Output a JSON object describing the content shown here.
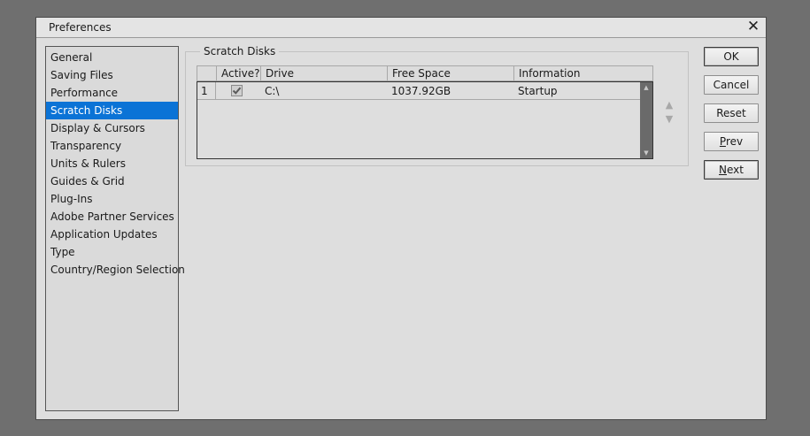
{
  "window": {
    "title": "Preferences"
  },
  "sidebar": {
    "items": [
      {
        "label": "General"
      },
      {
        "label": "Saving Files"
      },
      {
        "label": "Performance"
      },
      {
        "label": "Scratch Disks",
        "selected": true
      },
      {
        "label": "Display & Cursors"
      },
      {
        "label": "Transparency"
      },
      {
        "label": "Units & Rulers"
      },
      {
        "label": "Guides & Grid"
      },
      {
        "label": "Plug-Ins"
      },
      {
        "label": "Adobe Partner Services"
      },
      {
        "label": "Application Updates"
      },
      {
        "label": "Type"
      },
      {
        "label": "Country/Region Selection"
      }
    ]
  },
  "scratch_disks": {
    "group_title": "Scratch Disks",
    "columns": [
      "Active?",
      "Drive",
      "Free Space",
      "Information"
    ],
    "rows": [
      {
        "index": "1",
        "active": true,
        "drive": "C:\\",
        "free_space": "1037.92GB",
        "information": "Startup"
      }
    ]
  },
  "buttons": {
    "ok": "OK",
    "cancel": "Cancel",
    "reset": "Reset",
    "prev": "Prev",
    "next": "Next"
  },
  "icons": {
    "close": "close-icon",
    "move_up": "triangle-up-icon",
    "move_down": "triangle-down-icon",
    "check": "checkmark-icon"
  },
  "colors": {
    "selection": "#0b73d6",
    "backdrop": "#6f6f6f",
    "dialog": "#dedede"
  }
}
